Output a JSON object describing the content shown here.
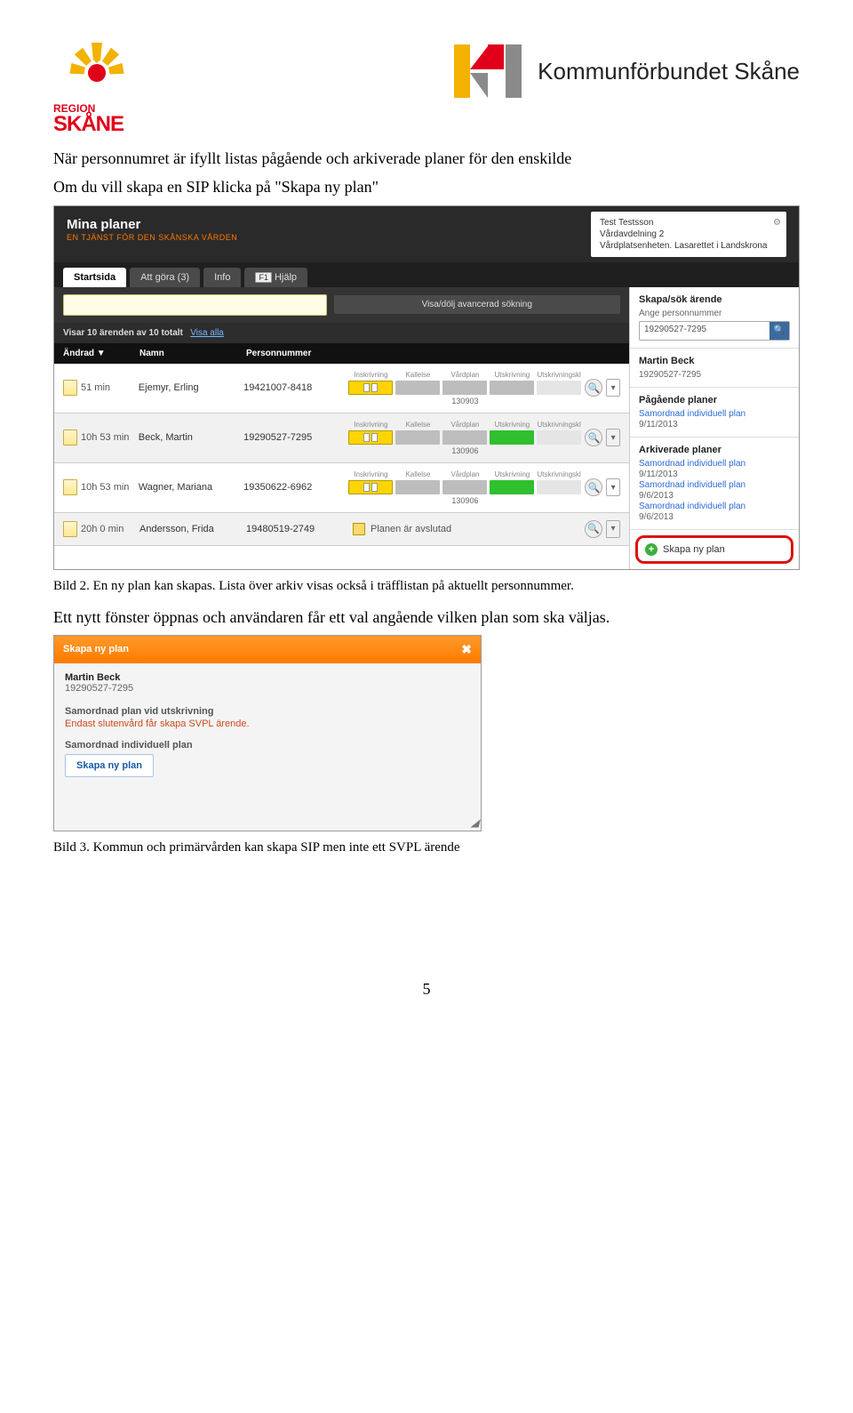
{
  "logos": {
    "skane_region": "REGION",
    "skane_name": "SKÅNE",
    "ksk": "Kommunförbundet Skåne"
  },
  "p1a": "När personnumret är ifyllt listas pågående och arkiverade planer för den enskilde",
  "p1b": "Om du vill skapa en SIP klicka på \"Skapa ny plan\"",
  "shot1": {
    "title": "Mina planer",
    "title_orange": "E",
    "subtitle": "N   TJÄNST FÖR DEN SKÅNSKA VÅRDEN",
    "user": {
      "name": "Test Testsson",
      "unit": "Vårdavdelning 2",
      "loc": "Vårdplatsenheten. Lasarettet i Landskrona"
    },
    "tabs": {
      "t1": "Startsida",
      "t2": "Att göra (3)",
      "t3": "Info",
      "t4": "Hjälp",
      "t4_kbd": "F1"
    },
    "search_adv": "Visa/dölj avancerad sökning",
    "list_summary": "Visar 10 ärenden av 10 totalt",
    "list_showall": "Visa alla",
    "cols": {
      "c1": "Ändrad ▼",
      "c2": "Namn",
      "c3": "Personnummer"
    },
    "steplabels": [
      "Inskrivning",
      "Kallelse",
      "Vårdplan",
      "Utskrivning",
      "Utskrivningsklar"
    ],
    "rows": [
      {
        "time": "51 min",
        "name": "Ejemyr, Erling",
        "pn": "19421007-8418",
        "date": "130903",
        "pattern": [
          "y",
          "gr",
          "gr",
          "gr",
          "gr"
        ]
      },
      {
        "time": "10h 53 min",
        "name": "Beck, Martin",
        "pn": "19290527-7295",
        "date": "130906",
        "pattern": [
          "y",
          "gr",
          "gr",
          "g",
          "gr"
        ]
      },
      {
        "time": "10h 53 min",
        "name": "Wagner, Mariana",
        "pn": "19350622-6962",
        "date": "130906",
        "pattern": [
          "y",
          "gr",
          "gr",
          "g",
          "gr"
        ]
      },
      {
        "time": "20h 0 min",
        "name": "Andersson, Frida",
        "pn": "19480519-2749",
        "done": "Planen är avslutad"
      }
    ],
    "side": {
      "create_h": "Skapa/sök ärende",
      "create_lbl": "Ange personnummer",
      "create_val": "19290527-7295",
      "person_name": "Martin Beck",
      "person_pn": "19290527-7295",
      "pending_h": "Pågående planer",
      "pending1": "Samordnad individuell plan",
      "pending1_d": "9/11/2013",
      "arch_h": "Arkiverade planer",
      "arch1": "Samordnad individuell plan",
      "arch1_d": "9/11/2013",
      "arch2": "Samordnad individuell plan",
      "arch2_d": "9/6/2013",
      "arch3": "Samordnad individuell plan",
      "arch3_d": "9/6/2013",
      "newplan": "Skapa ny plan"
    }
  },
  "cap1": "Bild 2. En ny plan kan skapas. Lista över arkiv visas också i träfflistan på aktuellt personnummer.",
  "p2": "Ett nytt fönster öppnas och användaren får ett val angående vilken plan som ska väljas.",
  "shot2": {
    "title": "Skapa ny plan",
    "name": "Martin Beck",
    "pn": "19290527-7295",
    "sec1": "Samordnad plan vid utskrivning",
    "warn": "Endast slutenvård får skapa SVPL ärende.",
    "sec2": "Samordnad individuell plan",
    "btn": "Skapa ny plan"
  },
  "cap2": "Bild 3. Kommun och primärvården kan skapa SIP men inte ett SVPL ärende",
  "page_number": "5"
}
